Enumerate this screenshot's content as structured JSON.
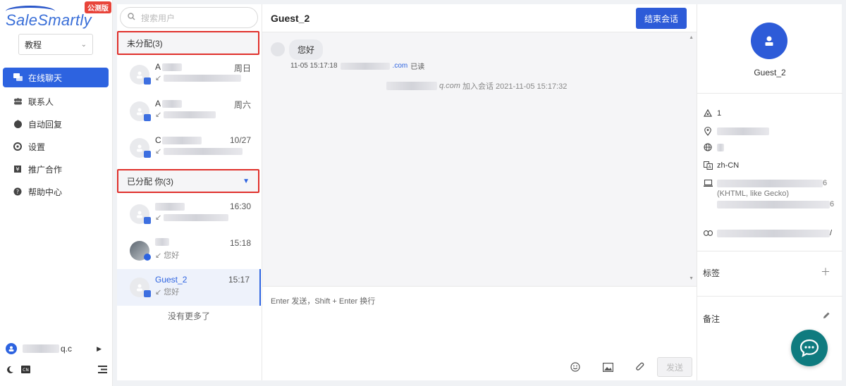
{
  "brand": {
    "logo_text": "SaleSmartly",
    "badge": "公测版"
  },
  "workspace": {
    "selected": "教程"
  },
  "nav": {
    "items": [
      {
        "label": "在线聊天",
        "icon": "chat-icon",
        "active": true
      },
      {
        "label": "联系人",
        "icon": "contacts-icon",
        "active": false
      },
      {
        "label": "自动回复",
        "icon": "robot-icon",
        "active": false
      },
      {
        "label": "设置",
        "icon": "gear-icon",
        "active": false
      },
      {
        "label": "推广合作",
        "icon": "affiliate-icon",
        "active": false
      },
      {
        "label": "帮助中心",
        "icon": "help-icon",
        "active": false
      }
    ]
  },
  "account": {
    "email_suffix": "q.c"
  },
  "conversation_list": {
    "search_placeholder": "搜索用户",
    "unassigned_header": "未分配(3)",
    "assigned_header": "已分配   你(3)",
    "unassigned": [
      {
        "name": "A",
        "time": "周日",
        "preview": ""
      },
      {
        "name": "A",
        "time": "周六",
        "preview": ""
      },
      {
        "name": "C",
        "time": "10/27",
        "preview": ""
      }
    ],
    "assigned": [
      {
        "name": "",
        "time": "16:30",
        "preview": ""
      },
      {
        "name": "",
        "time": "15:18",
        "preview": "您好"
      },
      {
        "name": "Guest_2",
        "time": "15:17",
        "preview": "您好"
      }
    ],
    "no_more": "没有更多了"
  },
  "chat": {
    "title": "Guest_2",
    "end_button": "结束会话",
    "messages": [
      {
        "text": "您好",
        "timestamp": "11-05 15:17:18",
        "email_suffix": ".com",
        "status": "已读"
      }
    ],
    "system_note": {
      "email_suffix": "q.com",
      "text": "加入会话 2021-11-05 15:17:32"
    },
    "composer_placeholder": "Enter 发送，Shift + Enter 换行",
    "send_button": "发送"
  },
  "contact_info": {
    "name": "Guest_2",
    "visits": "1",
    "language": "zh-CN",
    "ua_fragments": {
      "line1_end": "6",
      "line2": "(KHTML, like Gecko)",
      "line3_end": "6",
      "url_end": "/"
    },
    "tags_label": "标签",
    "notes_label": "备注"
  }
}
